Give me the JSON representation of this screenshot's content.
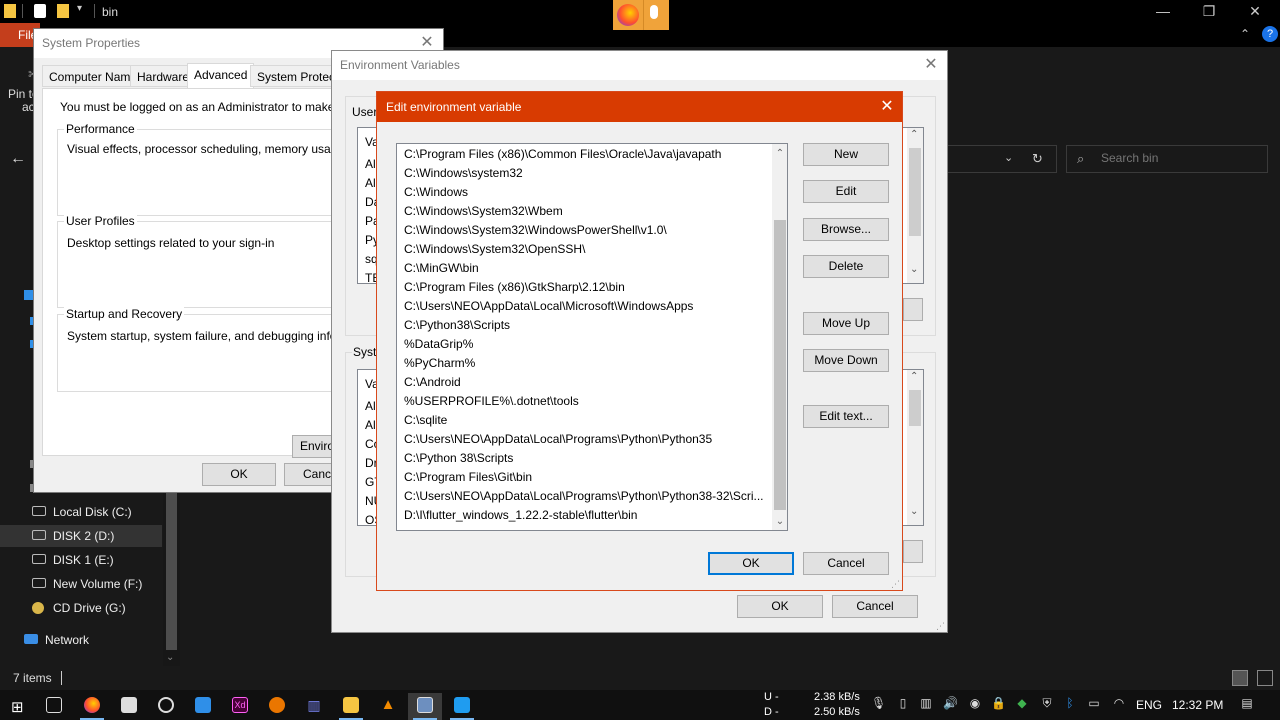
{
  "explorer": {
    "title": "bin",
    "file_tab": "File",
    "pin_label_1": "Pin to",
    "pin_label_2": "ac",
    "search_placeholder": "Search bin",
    "status_items": "7 items",
    "nav_items": [
      {
        "label": "Local Disk (C:)",
        "selected": false
      },
      {
        "label": "DISK 2 (D:)",
        "selected": true
      },
      {
        "label": "DISK 1 (E:)",
        "selected": false
      },
      {
        "label": "New Volume (F:)",
        "selected": false
      },
      {
        "label": "CD Drive (G:)",
        "selected": false
      },
      {
        "label": "Network",
        "selected": false
      }
    ]
  },
  "system_properties": {
    "title": "System Properties",
    "tabs": [
      "Computer Name",
      "Hardware",
      "Advanced",
      "System Protection"
    ],
    "active_tab": "Advanced",
    "admin_note": "You must be logged on as an Administrator to make most c",
    "performance": {
      "legend": "Performance",
      "desc": "Visual effects, processor scheduling, memory usage, and"
    },
    "user_profiles": {
      "legend": "User Profiles",
      "desc": "Desktop settings related to your sign-in"
    },
    "startup_recovery": {
      "legend": "Startup and Recovery",
      "desc": "System startup, system failure, and debugging information"
    },
    "env_button": "Environ",
    "ok": "OK",
    "cancel": "Cance"
  },
  "environment_variables": {
    "title": "Environment Variables",
    "user_group_label": "User",
    "system_group_label": "Syste",
    "user_rows": [
      "Va",
      "Al",
      "Al",
      "Da",
      "Pa",
      "Py",
      "sq",
      "TE"
    ],
    "system_rows": [
      "Va",
      "Al",
      "Al",
      "Co",
      "Dr",
      "GT",
      "NU",
      "OS"
    ],
    "ok": "OK",
    "cancel": "Cancel"
  },
  "edit_env": {
    "title": "Edit environment variable",
    "paths": [
      "C:\\Program Files (x86)\\Common Files\\Oracle\\Java\\javapath",
      "C:\\Windows\\system32",
      "C:\\Windows",
      "C:\\Windows\\System32\\Wbem",
      "C:\\Windows\\System32\\WindowsPowerShell\\v1.0\\",
      "C:\\Windows\\System32\\OpenSSH\\",
      "C:\\MinGW\\bin",
      "C:\\Program Files (x86)\\GtkSharp\\2.12\\bin",
      "C:\\Users\\NEO\\AppData\\Local\\Microsoft\\WindowsApps",
      "C:\\Python38\\Scripts",
      "%DataGrip%",
      "%PyCharm%",
      "C:\\Android",
      "%USERPROFILE%\\.dotnet\\tools",
      "C:\\sqlite",
      "C:\\Users\\NEO\\AppData\\Local\\Programs\\Python\\Python35",
      "C:\\Python 38\\Scripts",
      "C:\\Program Files\\Git\\bin",
      "C:\\Users\\NEO\\AppData\\Local\\Programs\\Python\\Python38-32\\Scri...",
      "D:\\I\\flutter_windows_1.22.2-stable\\flutter\\bin"
    ],
    "buttons": {
      "new": "New",
      "edit": "Edit",
      "browse": "Browse...",
      "delete": "Delete",
      "move_up": "Move Up",
      "move_down": "Move Down",
      "edit_text": "Edit text...",
      "ok": "OK",
      "cancel": "Cancel"
    },
    "accent_color": "#d83b01"
  },
  "taskbar": {
    "net_up_label": "U -",
    "net_down_label": "D -",
    "net_up": "2.38 kB/s",
    "net_down": "2.50 kB/s",
    "language": "ENG",
    "time": "12:32 PM"
  }
}
